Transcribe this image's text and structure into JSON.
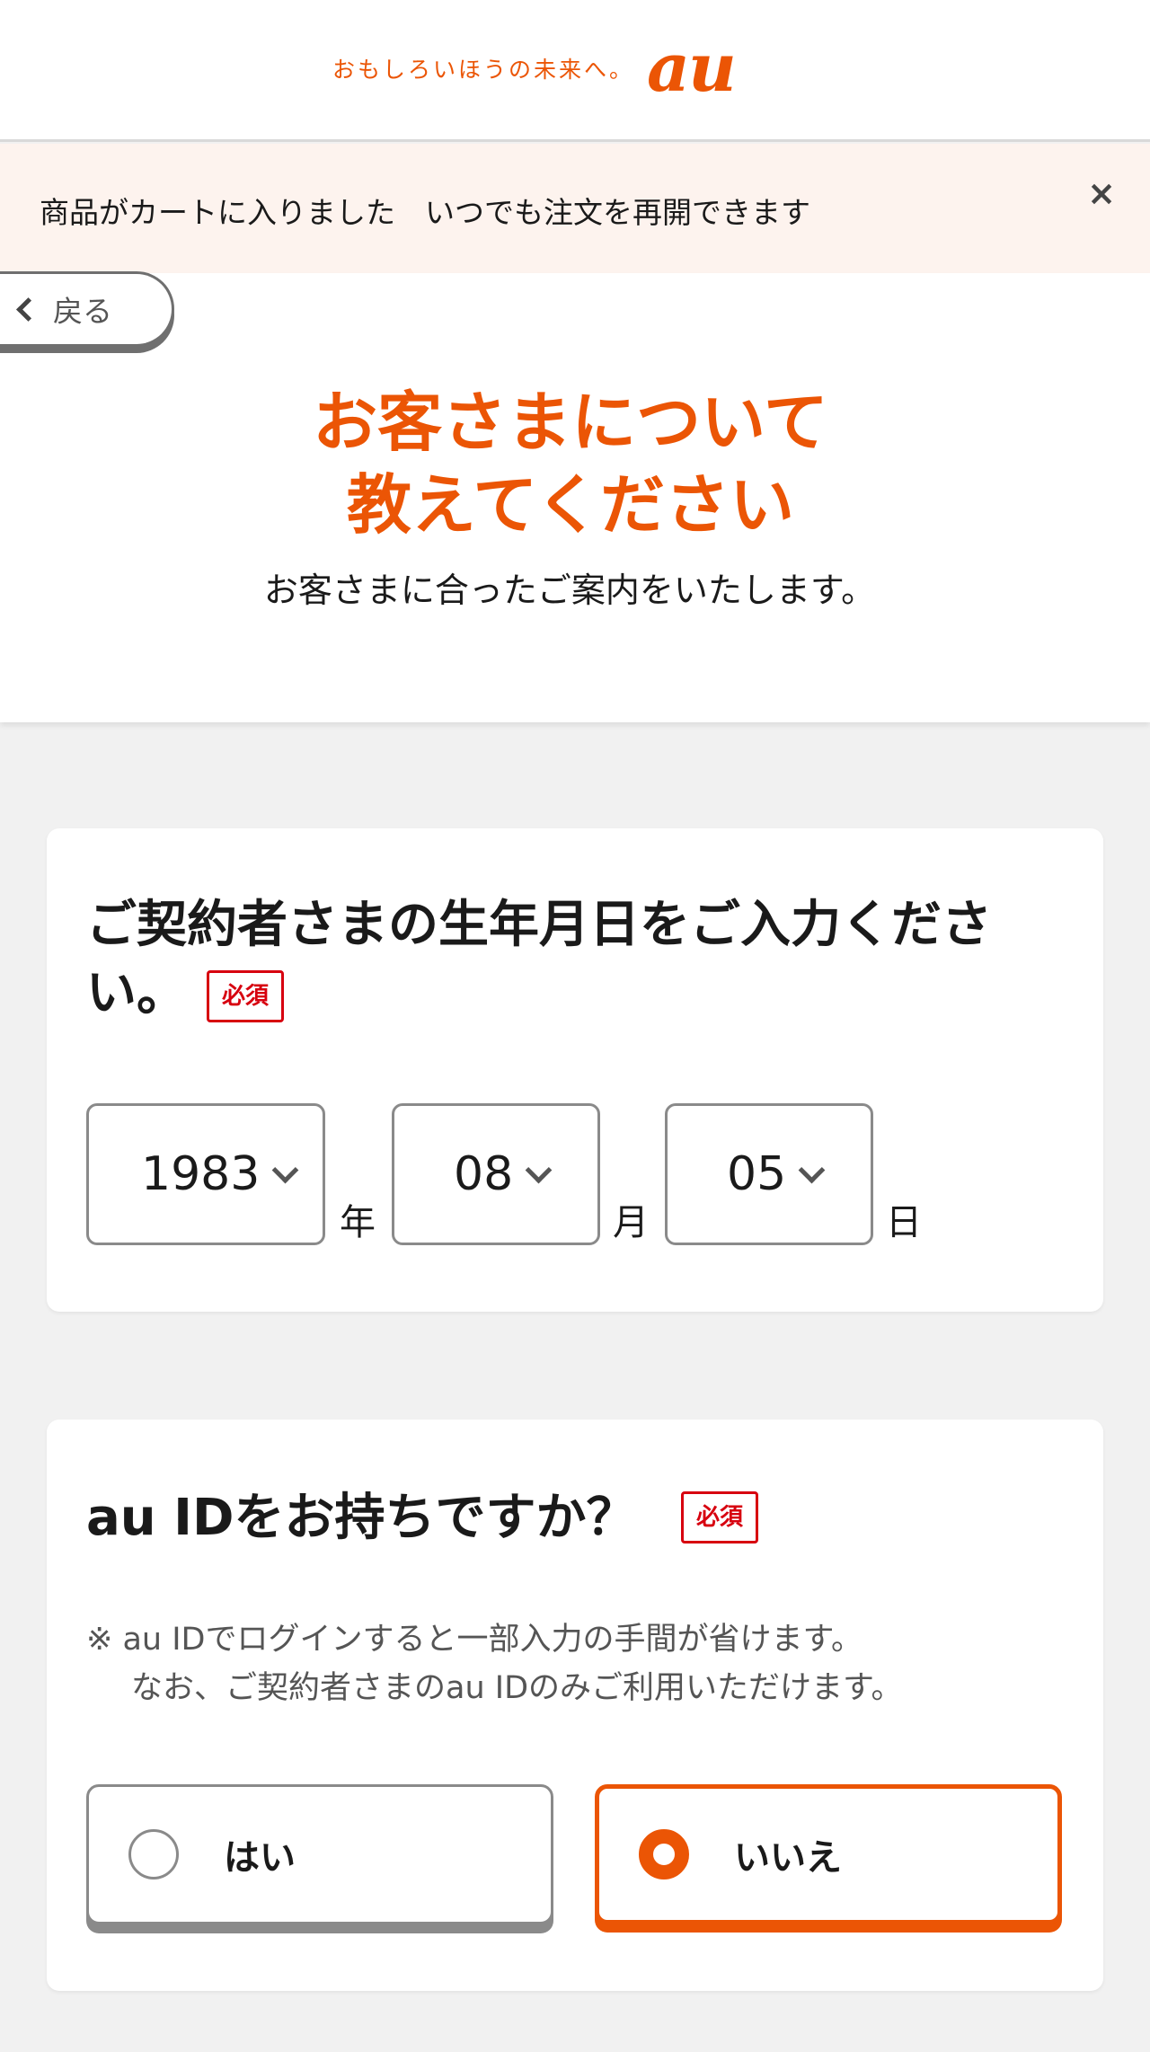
{
  "header": {
    "tagline": "おもしろいほうの未来へ。",
    "logo_text": "au"
  },
  "notice": {
    "text": "商品がカートに入りました　いつでも注文を再開できます",
    "close_label": "×"
  },
  "back": {
    "label": "戻る"
  },
  "page": {
    "title_line1": "お客さまについて",
    "title_line2": "教えてください",
    "subtitle": "お客さまに合ったご案内をいたします。"
  },
  "birthdate": {
    "question": "ご契約者さまの生年月日をご入力ください。",
    "required_label": "必須",
    "year": {
      "value": "1983",
      "unit": "年"
    },
    "month": {
      "value": "08",
      "unit": "月"
    },
    "day": {
      "value": "05",
      "unit": "日"
    }
  },
  "auid": {
    "question": "au IDをお持ちですか？",
    "required_label": "必須",
    "note_line1": "※ au IDでログインすると一部入力の手間が省けます。",
    "note_line2": "なお、ご契約者さまのau IDのみご利用いただけます。",
    "options": [
      {
        "label": "はい",
        "selected": false
      },
      {
        "label": "いいえ",
        "selected": true
      }
    ]
  },
  "colors": {
    "accent": "#eb5505",
    "required": "#d7000f",
    "background": "#f1f1f1"
  }
}
